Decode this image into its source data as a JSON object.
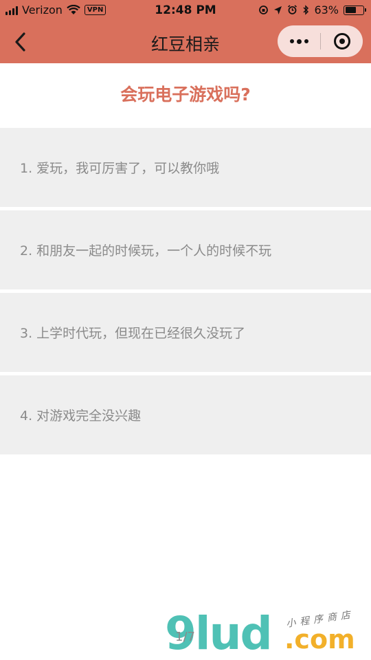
{
  "status_bar": {
    "carrier": "Verizon",
    "vpn": "VPN",
    "time": "12:48 PM",
    "battery": "63%",
    "battery_level": 0.63
  },
  "nav": {
    "title": "红豆相亲"
  },
  "question": "会玩电子游戏吗?",
  "options": [
    "1. 爱玩，我可厉害了，可以教你哦",
    "2. 和朋友一起的时候玩，一个人的时候不玩",
    "3. 上学时代玩，但现在已经很久没玩了",
    "4. 对游戏完全没兴趣"
  ],
  "pager": "1/7",
  "watermark": {
    "brand": "9lud",
    "domain": ".com",
    "tagline": "小程序商店"
  },
  "colors": {
    "accent": "#d9705c",
    "option_bg": "#efefef",
    "option_text": "#8a8a8a"
  }
}
